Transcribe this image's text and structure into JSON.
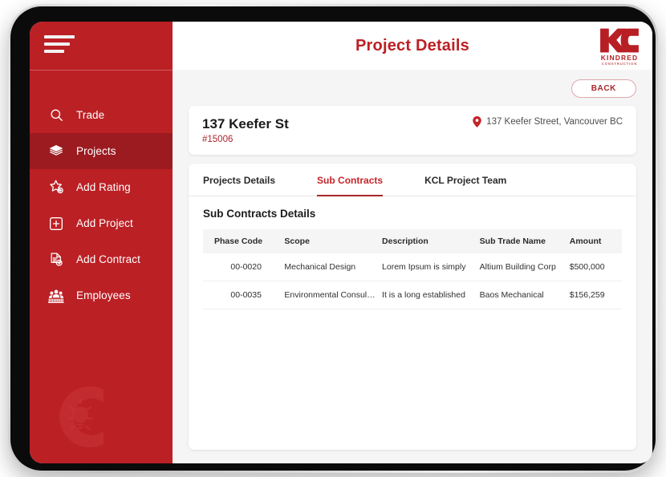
{
  "sidebar": {
    "menu_icon": "hamburger-icon",
    "watermark_icon": "kcl-c-bulb-watermark",
    "items": [
      {
        "label": "Trade",
        "icon": "search-icon",
        "active": false
      },
      {
        "label": "Projects",
        "icon": "layers-icon",
        "active": true
      },
      {
        "label": "Add Rating",
        "icon": "star-plus-icon",
        "active": false
      },
      {
        "label": "Add Project",
        "icon": "square-plus-icon",
        "active": false
      },
      {
        "label": "Add Contract",
        "icon": "document-add-icon",
        "active": false
      },
      {
        "label": "Employees",
        "icon": "people-group-icon",
        "active": false
      }
    ]
  },
  "header": {
    "title": "Project Details",
    "logo": {
      "mark": "kc-monogram-icon",
      "name": "KINDRED",
      "sub": "CONSTRUCTION"
    }
  },
  "toolbar": {
    "back_label": "BACK"
  },
  "project": {
    "name": "137 Keefer St",
    "code": "#15006",
    "location_icon": "map-pin-icon",
    "address": "137 Keefer Street, Vancouver BC"
  },
  "tabs": [
    {
      "label": "Projects Details",
      "active": false
    },
    {
      "label": "Sub Contracts",
      "active": true
    },
    {
      "label": "KCL Project Team",
      "active": false
    }
  ],
  "subcontracts": {
    "section_title": "Sub Contracts Details",
    "columns": [
      "Phase Code",
      "Scope",
      "Description",
      "Sub Trade Name",
      "Amount"
    ],
    "rows": [
      {
        "phase_code": "00-0020",
        "scope": "Mechanical Design",
        "description": "Lorem Ipsum is simply",
        "sub_trade_name": "Altium Building Corp",
        "amount": "$500,000"
      },
      {
        "phase_code": "00-0035",
        "scope": "Environmental Consultant",
        "description": "It is a long established",
        "sub_trade_name": "Baos Mechanical",
        "amount": "$156,259"
      }
    ]
  },
  "colors": {
    "brand_red": "#bb2025",
    "sidebar_active_red": "#9c1b20",
    "accent_text_red": "#a8262c",
    "page_background": "#f5f5f6",
    "card_background": "#ffffff"
  }
}
